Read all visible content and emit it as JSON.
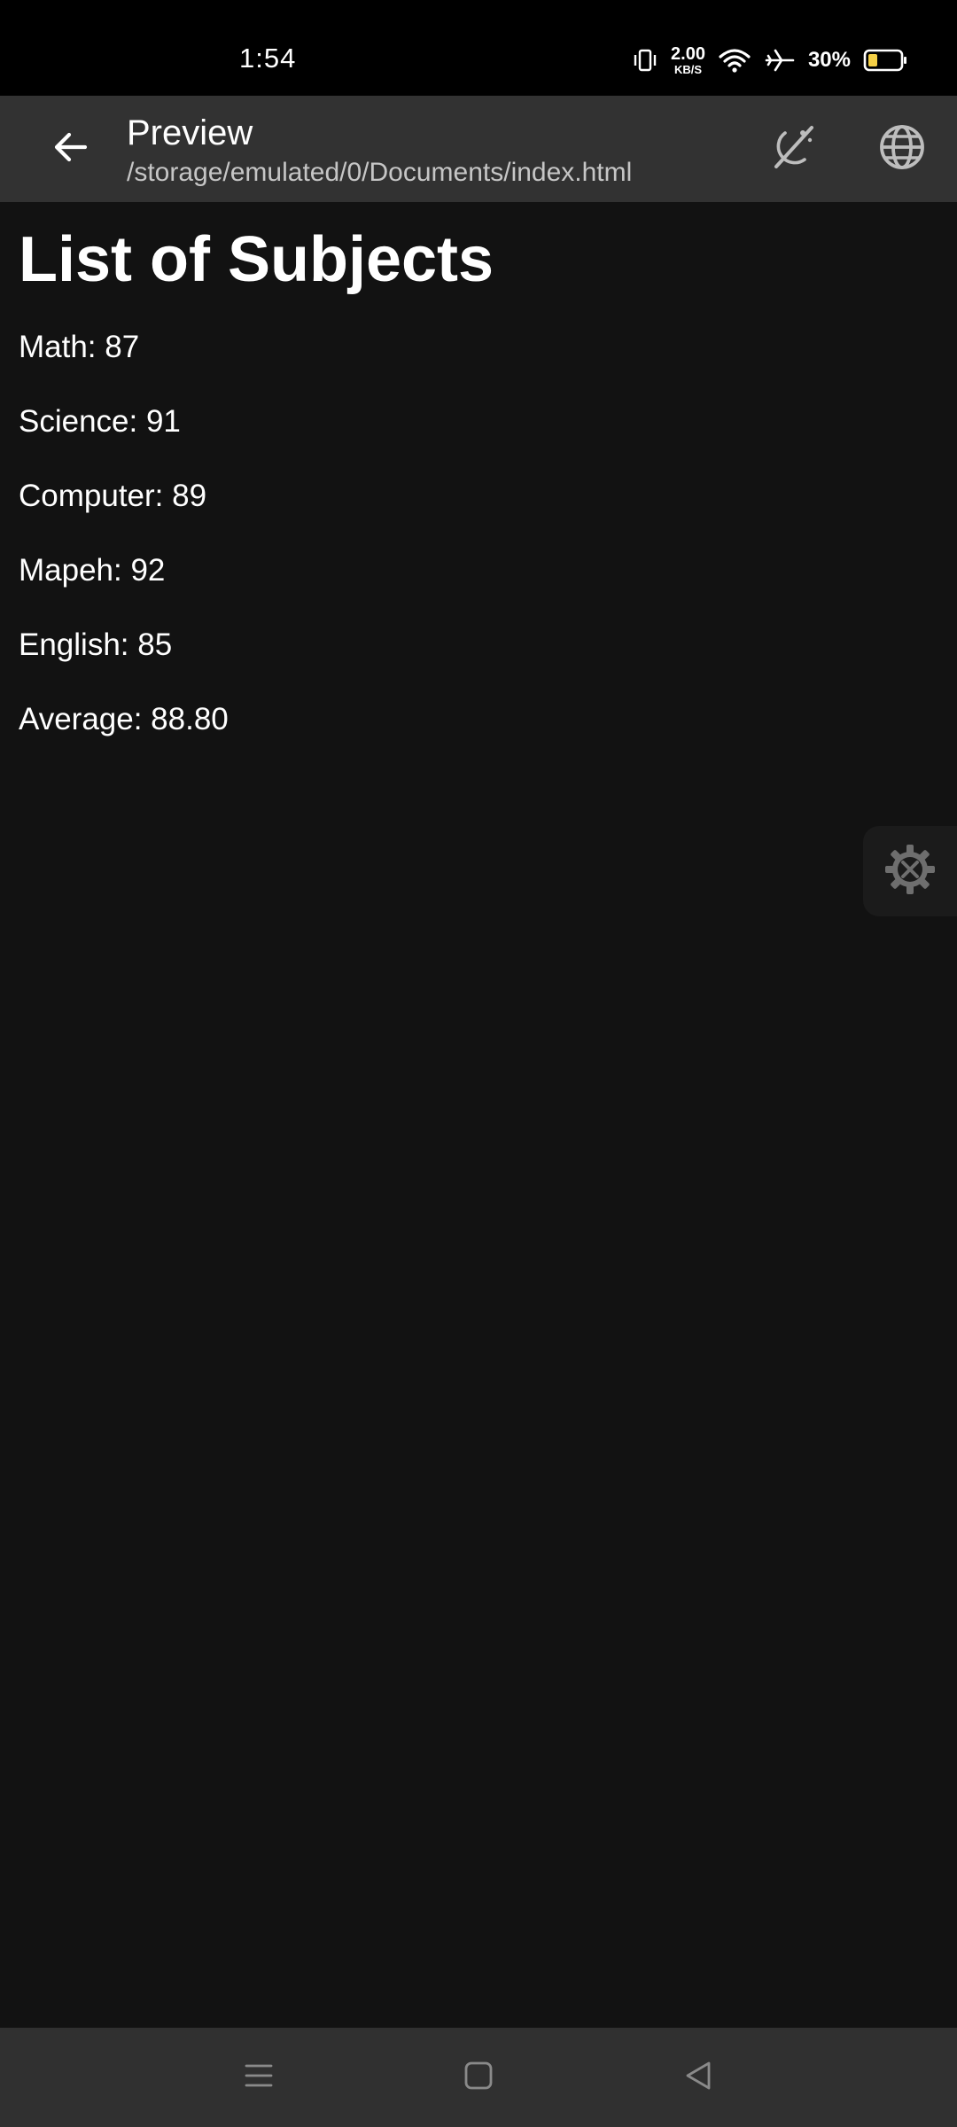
{
  "status_bar": {
    "time": "1:54",
    "net_speed_value": "2.00",
    "net_speed_unit": "KB/S",
    "battery_percent": "30%",
    "icons": [
      "vibrate-icon",
      "wifi-icon",
      "airplane-icon",
      "battery-icon"
    ]
  },
  "app_bar": {
    "title": "Preview",
    "path": "/storage/emulated/0/Documents/index.html",
    "icons": [
      "back-arrow-icon",
      "theme-toggle-icon",
      "globe-icon"
    ]
  },
  "page": {
    "heading": "List of Subjects",
    "lines": [
      "Math: 87",
      "Science: 91",
      "Computer: 89",
      "Mapeh: 92",
      "English: 85",
      "Average: 88.80"
    ]
  },
  "floating": {
    "icon": "settings-tools-icon"
  },
  "nav_bar": {
    "icons": [
      "menu-icon",
      "home-icon",
      "back-icon"
    ]
  },
  "colors": {
    "background": "#121212",
    "app_bar": "#323232",
    "status_bar": "#000000",
    "nav_bar": "#303030",
    "text": "#ffffff",
    "subtitle": "#c6c6c6"
  }
}
